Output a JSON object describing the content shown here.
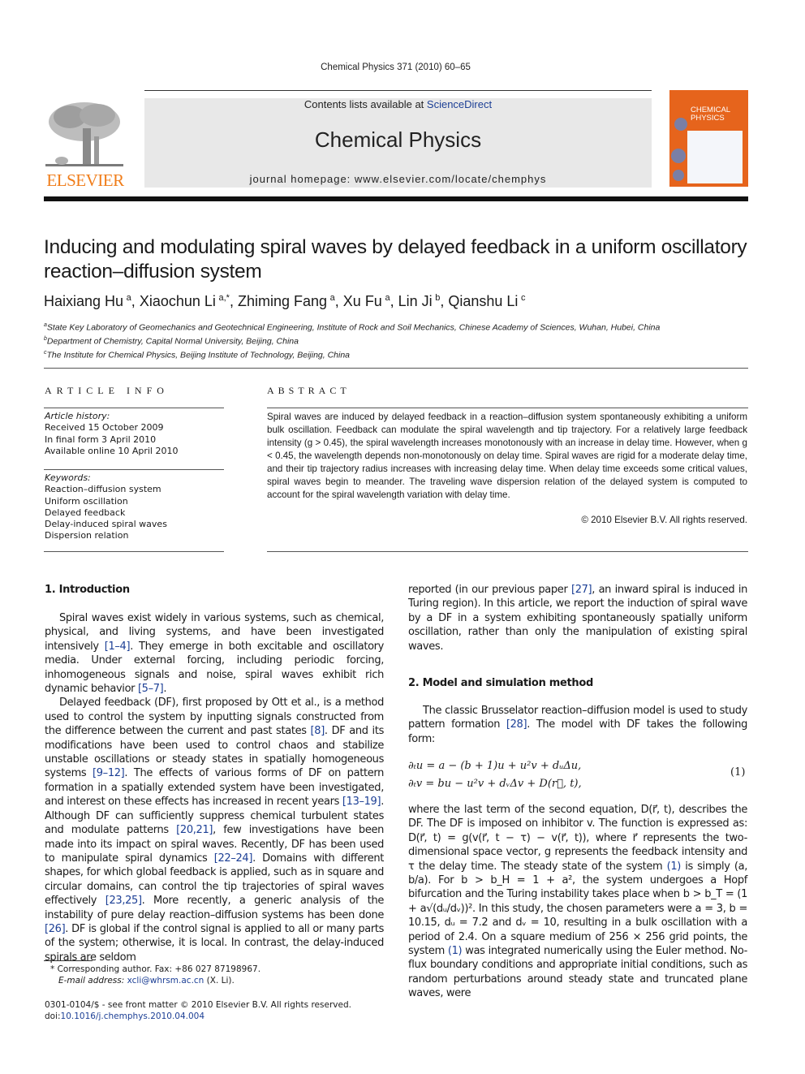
{
  "header": {
    "citation": "Chemical Physics 371 (2010) 60–65",
    "contents_prefix": "Contents lists available at ",
    "contents_link": "ScienceDirect",
    "journal_title": "Chemical Physics",
    "homepage": "journal homepage: www.elsevier.com/locate/chemphys",
    "publisher_logo_text": "ELSEVIER",
    "cover_title_line1": "CHEMICAL",
    "cover_title_line2": "PHYSICS",
    "colors": {
      "elsevier_orange": "#f07d1a",
      "cover_orange": "#e6641c",
      "link_blue": "#1c3f95",
      "banner_gray": "#e8e8e8"
    }
  },
  "article": {
    "title": "Inducing and modulating spiral waves by delayed feedback in a uniform oscillatory reaction–diffusion system",
    "authors": [
      {
        "name": "Haixiang Hu",
        "aff": "a"
      },
      {
        "name": "Xiaochun Li",
        "aff": "a,*"
      },
      {
        "name": "Zhiming Fang",
        "aff": "a"
      },
      {
        "name": "Xu Fu",
        "aff": "a"
      },
      {
        "name": "Lin Ji",
        "aff": "b"
      },
      {
        "name": "Qianshu Li",
        "aff": "c"
      }
    ],
    "affiliations": [
      {
        "mark": "a",
        "text": "State Key Laboratory of Geomechanics and Geotechnical Engineering, Institute of Rock and Soil Mechanics, Chinese Academy of Sciences, Wuhan, Hubei, China"
      },
      {
        "mark": "b",
        "text": "Department of Chemistry, Capital Normal University, Beijing, China"
      },
      {
        "mark": "c",
        "text": "The Institute for Chemical Physics, Beijing Institute of Technology, Beijing, China"
      }
    ]
  },
  "article_info": {
    "heading": "ARTICLE INFO",
    "history_label": "Article history:",
    "history": [
      "Received 15 October 2009",
      "In final form 3 April 2010",
      "Available online 10 April 2010"
    ],
    "keywords_label": "Keywords:",
    "keywords": [
      "Reaction–diffusion system",
      "Uniform oscillation",
      "Delayed feedback",
      "Delay-induced spiral waves",
      "Dispersion relation"
    ]
  },
  "abstract": {
    "heading": "ABSTRACT",
    "text": "Spiral waves are induced by delayed feedback in a reaction–diffusion system spontaneously exhibiting a uniform bulk oscillation. Feedback can modulate the spiral wavelength and tip trajectory. For a relatively large feedback intensity (g > 0.45), the spiral wavelength increases monotonously with an increase in delay time. However, when g < 0.45, the wavelength depends non-monotonously on delay time. Spiral waves are rigid for a moderate delay time, and their tip trajectory radius increases with increasing delay time. When delay time exceeds some critical values, spiral waves begin to meander. The traveling wave dispersion relation of the delayed system is computed to account for the spiral wavelength variation with delay time.",
    "copyright": "© 2010 Elsevier B.V. All rights reserved."
  },
  "sections": {
    "intro_heading": "1. Introduction",
    "intro_p1": [
      "Spiral waves exist widely in various systems, such as chemical, physical, and living systems, and have been investigated intensively ",
      "[1–4]",
      ". They emerge in both excitable and oscillatory media. Under external forcing, including periodic forcing, inhomogeneous signals and noise, spiral waves exhibit rich dynamic behavior ",
      "[5–7]",
      "."
    ],
    "intro_p2": [
      "Delayed feedback (DF), first proposed by Ott et al., is a method used to control the system by inputting signals constructed from the difference between the current and past states ",
      "[8]",
      ". DF and its modifications have been used to control chaos and stabilize unstable oscillations or steady states in spatially homogeneous systems ",
      "[9–12]",
      ". The effects of various forms of DF on pattern formation in a spatially extended system have been investigated, and interest on these effects has increased in recent years ",
      "[13–19]",
      ". Although DF can sufficiently suppress chemical turbulent states and modulate patterns ",
      "[20,21]",
      ", few investigations have been made into its impact on spiral waves. Recently, DF has been used to manipulate spiral dynamics ",
      "[22–24]",
      ". Domains with different shapes, for which global feedback is applied, such as in square and circular domains, can control the tip trajectories of spiral waves effectively ",
      "[23,25]",
      ". More recently, a generic analysis of the instability of pure delay reaction–diffusion systems has been done ",
      "[26]",
      ". DF is global if the control signal is applied to all or many parts of the system; otherwise, it is local. In contrast, the delay-induced spirals are seldom"
    ],
    "intro_p3": [
      "reported (in our previous paper ",
      "[27]",
      ", an inward spiral is induced in Turing region). In this article, we report the induction of spiral wave by a DF in a system exhibiting spontaneously spatially uniform oscillation, rather than only the manipulation of existing spiral waves."
    ],
    "model_heading": "2. Model and simulation method",
    "model_p1": [
      "The classic Brusselator reaction–diffusion model is used to study pattern formation ",
      "[28]",
      ". The model with DF takes the following form:"
    ],
    "equation_line1": "∂ₜu = a − (b + 1)u + u²v + dᵤΔu,",
    "equation_line2": "∂ₜv = bu − u²v + dᵥΔv + D(r⃗, t),",
    "equation_number": "(1)",
    "model_p2": [
      "where the last term of the second equation, D(r⃗, t), describes the DF. The DF is imposed on inhibitor v. The function is expressed as: D(r⃗, t) = g(v(r⃗, t − τ) − v(r⃗, t)), where r⃗ represents the two-dimensional space vector, g represents the feedback intensity and τ the delay time. The steady state of the system ",
      "(1)",
      " is simply (a, b/a). For b > b_H = 1 + a², the system undergoes a Hopf bifurcation and the Turing instability takes place when b > b_T = (1 + a√(dᵤ/dᵥ))². In this study, the chosen parameters were a = 3, b = 10.15, dᵤ = 7.2 and dᵥ = 10, resulting in a bulk oscillation with a period of 2.4. On a square medium of 256 × 256 grid points, the system ",
      "(1)",
      " was integrated numerically using the Euler method. No-flux boundary conditions and appropriate initial conditions, such as random perturbations around steady state and truncated plane waves, were"
    ]
  },
  "footnotes": {
    "corresponding": "* Corresponding author. Fax: +86 027 87198967.",
    "email_label": "E-mail address: ",
    "email": "xcli@whrsm.ac.cn",
    "email_suffix": " (X. Li).",
    "front_matter": "0301-0104/$ - see front matter © 2010 Elsevier B.V. All rights reserved.",
    "doi_prefix": "doi:",
    "doi": "10.1016/j.chemphys.2010.04.004"
  }
}
